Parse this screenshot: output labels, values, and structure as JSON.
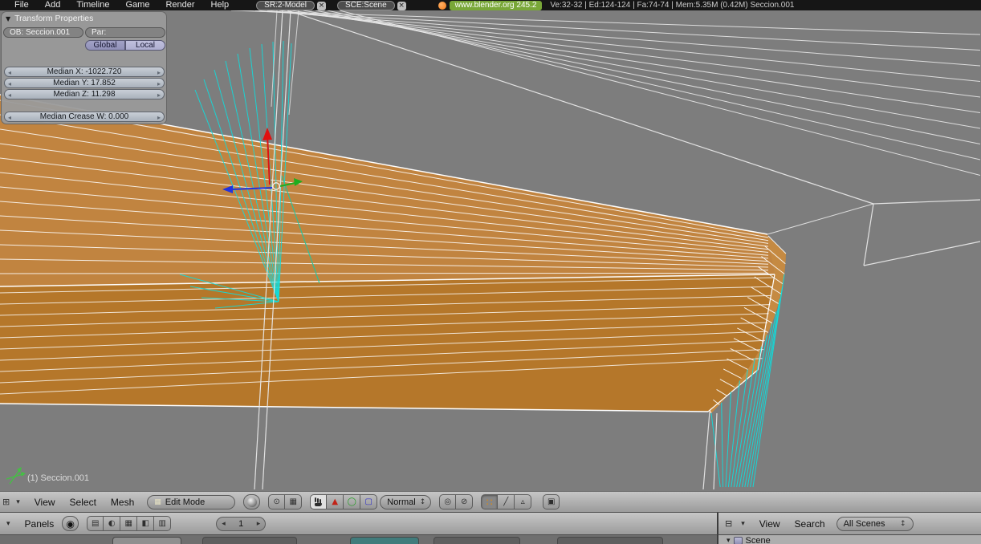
{
  "topbar": {
    "menus": [
      "File",
      "Add",
      "Timeline",
      "Game",
      "Render",
      "Help"
    ],
    "screen_field": "SR:2-Model",
    "scene_field": "SCE:Scene",
    "site_label": "www.blender.org 245.2",
    "stats": "Ve:32-32 | Ed:124-124 | Fa:74-74 | Mem:5.35M (0.42M)   Seccion.001"
  },
  "transform_panel": {
    "title": "Transform Properties",
    "ob": "OB: Seccion.001",
    "par": "Par:",
    "global_label": "Global",
    "local_label": "Local",
    "median_x": "Median X: -1022.720",
    "median_y": "Median Y: 17.852",
    "median_z": "Median Z: 11.298",
    "median_crease": "Median Crease W: 0.000"
  },
  "viewport": {
    "object_label": "(1) Seccion.001"
  },
  "viewport_header": {
    "menus": [
      "View",
      "Select",
      "Mesh"
    ],
    "mode": "Edit Mode",
    "orientation": "Normal"
  },
  "buttons_header": {
    "panels": "Panels",
    "frame": "1"
  },
  "outliner_header": {
    "menus": [
      "View",
      "Search"
    ],
    "scenes": "All Scenes"
  },
  "outliner": {
    "root": "Scene"
  },
  "icons": {
    "close": "×",
    "collapse_tri": "▼",
    "menu_tri": "▾",
    "splitter": "⊞",
    "prev": "◂",
    "next": "▸",
    "updown": "↕",
    "editmode": "▦",
    "pivot": "⊙",
    "grid": "▦",
    "translate": "▲",
    "rotate": "◯",
    "scale": "▢",
    "prop_edit": "◎",
    "snap": "⊘",
    "vertex": "∷",
    "edge": "╱",
    "face": "▵",
    "render": "▣",
    "globe": "◉",
    "ctx_a": "▤",
    "ctx_b": "◐",
    "ctx_c": "▦",
    "ctx_d": "◧",
    "ctx_e": "▥",
    "outliner_type": "⊟"
  },
  "colors": {
    "selection_cyan": "#10dcdc",
    "mesh_orange": "#b5772a",
    "manipulator_red": "#e01010",
    "manipulator_green": "#1fae1f",
    "manipulator_blue": "#2233dd",
    "viewport_gray": "#7d7d7d"
  }
}
